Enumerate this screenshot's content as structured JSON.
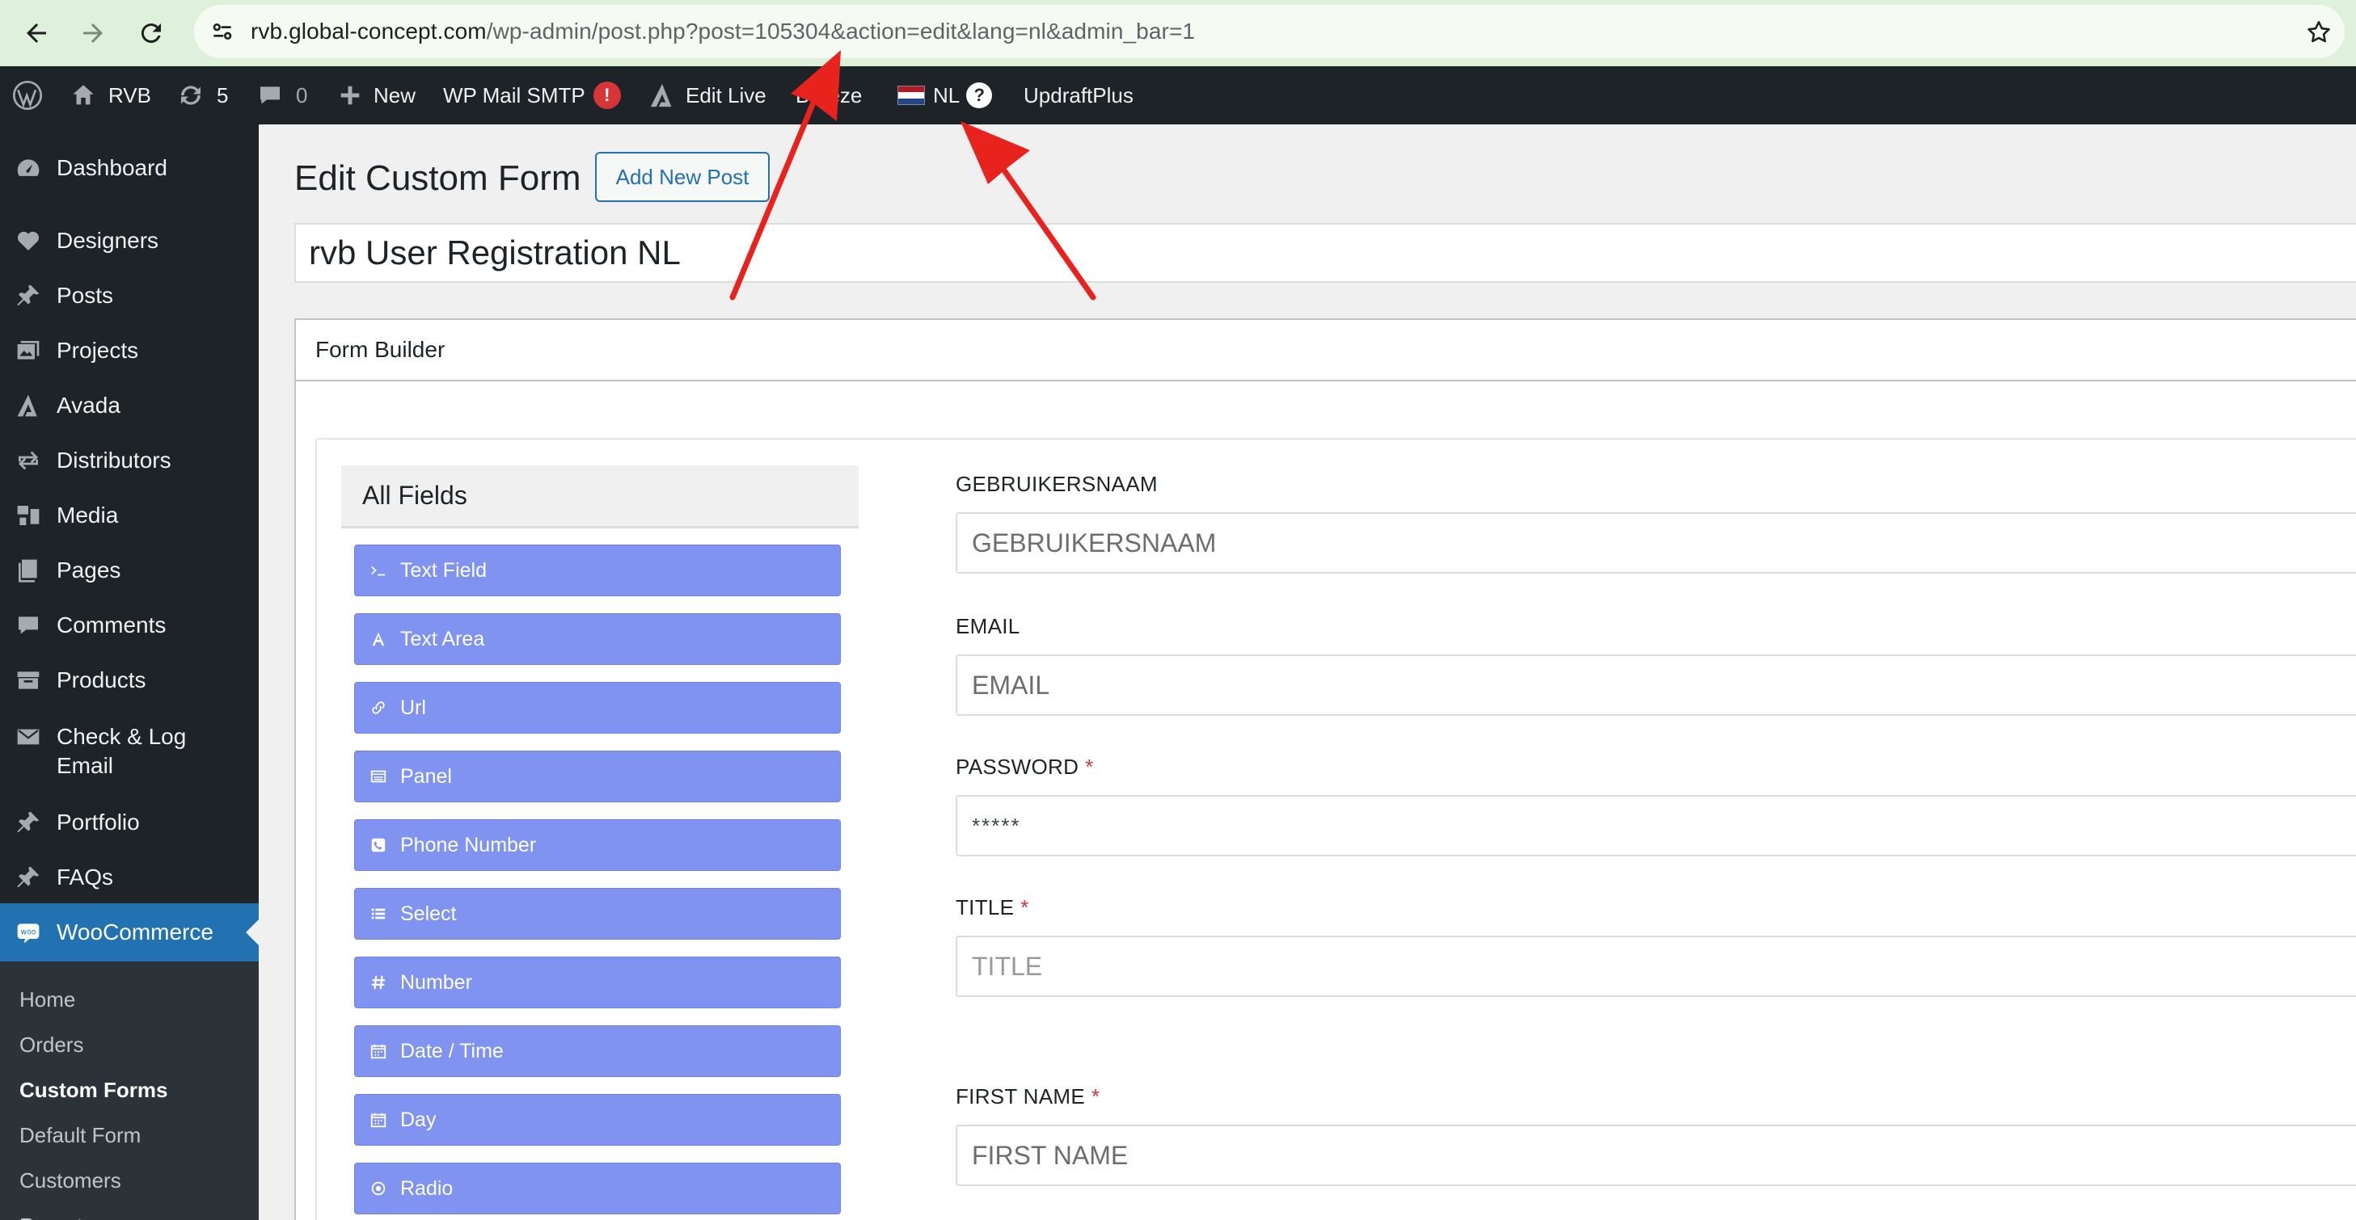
{
  "browser": {
    "url_host": "rvb.global-concept.com",
    "url_path": "/wp-admin/post.php?post=105304&action=edit&lang=nl&admin_bar=1"
  },
  "adminbar": {
    "site": "RVB",
    "updates": "5",
    "comments": "0",
    "new": "New",
    "mail": "WP Mail SMTP",
    "mail_badge": "!",
    "edit_live": "Edit Live",
    "breeze": "Breeze",
    "lang": "NL",
    "help": "?",
    "updraft": "UpdraftPlus"
  },
  "sidebar": {
    "items": [
      {
        "label": "Dashboard",
        "icon": "dashboard-icon"
      },
      {
        "label": "Designers",
        "icon": "heart-icon"
      },
      {
        "label": "Posts",
        "icon": "pin-icon"
      },
      {
        "label": "Projects",
        "icon": "gallery-icon"
      },
      {
        "label": "Avada",
        "icon": "avada-icon"
      },
      {
        "label": "Distributors",
        "icon": "arrows-icon"
      },
      {
        "label": "Media",
        "icon": "media-icon"
      },
      {
        "label": "Pages",
        "icon": "pages-icon"
      },
      {
        "label": "Comments",
        "icon": "comment-icon"
      },
      {
        "label": "Products",
        "icon": "archive-icon"
      },
      {
        "label": "Check & Log",
        "label2": "Email",
        "icon": "email-icon"
      },
      {
        "label": "Portfolio",
        "icon": "pin-icon"
      },
      {
        "label": "FAQs",
        "icon": "pin-icon"
      },
      {
        "label": "WooCommerce",
        "icon": "woo-icon"
      }
    ],
    "submenu": [
      "Home",
      "Orders",
      "Custom Forms",
      "Default Form",
      "Customers",
      "Reports"
    ]
  },
  "page": {
    "title": "Edit Custom Form",
    "add_new": "Add New Post",
    "post_title": "rvb User Registration NL",
    "box_title": "Form Builder"
  },
  "fields_panel": {
    "heading": "All Fields",
    "buttons": [
      {
        "label": "Text Field",
        "icon": "terminal-icon"
      },
      {
        "label": "Text Area",
        "icon": "font-icon"
      },
      {
        "label": "Url",
        "icon": "link-icon"
      },
      {
        "label": "Panel",
        "icon": "panel-icon"
      },
      {
        "label": "Phone Number",
        "icon": "phone-icon"
      },
      {
        "label": "Select",
        "icon": "list-icon"
      },
      {
        "label": "Number",
        "icon": "hash-icon"
      },
      {
        "label": "Date / Time",
        "icon": "calendar-icon"
      },
      {
        "label": "Day",
        "icon": "calendar-icon"
      },
      {
        "label": "Radio",
        "icon": "radio-icon"
      }
    ]
  },
  "form": {
    "fields": [
      {
        "label": "GEBRUIKERSNAAM",
        "required": false,
        "placeholder": "GEBRUIKERSNAAM"
      },
      {
        "label": "EMAIL",
        "required": false,
        "placeholder": "EMAIL"
      },
      {
        "label": "PASSWORD",
        "required": true,
        "placeholder": "*****"
      },
      {
        "label": "TITLE",
        "required": true,
        "placeholder": "TITLE"
      },
      {
        "label": "FIRST NAME",
        "required": true,
        "placeholder": "FIRST NAME"
      }
    ],
    "required_mark": "*"
  },
  "colors": {
    "admin_dark": "#1d2327",
    "accent_blue": "#2271b1",
    "field_button": "#8093f1",
    "annotation_red": "#e8221c"
  }
}
